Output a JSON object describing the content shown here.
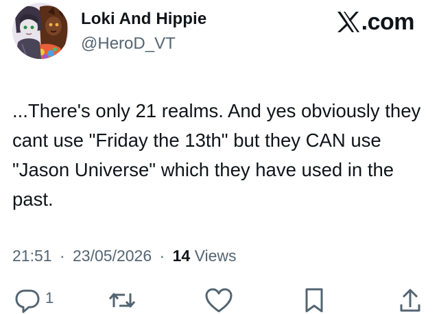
{
  "author": {
    "display_name": "Loki And Hippie",
    "handle": "@HeroD_VT",
    "avatar_icon": "avatar-illustration"
  },
  "brand": {
    "logo_icon": "x-logo-icon",
    "text": ".com"
  },
  "tweet": {
    "text": "...There's only 21 realms. And yes obviously they cant use \"Friday the 13th\" but they CAN use \"Jason Universe\" which they have used in the past.",
    "time": "21:51",
    "date": "23/05/2026",
    "separator": "·",
    "views_count": "14",
    "views_label": "Views"
  },
  "actions": {
    "reply_icon": "reply-icon",
    "reply_count": "1",
    "repost_icon": "repost-icon",
    "like_icon": "like-icon",
    "bookmark_icon": "bookmark-icon",
    "share_icon": "share-icon"
  },
  "colors": {
    "text_primary": "#0f1419",
    "text_secondary": "#536471",
    "background": "#ffffff"
  }
}
